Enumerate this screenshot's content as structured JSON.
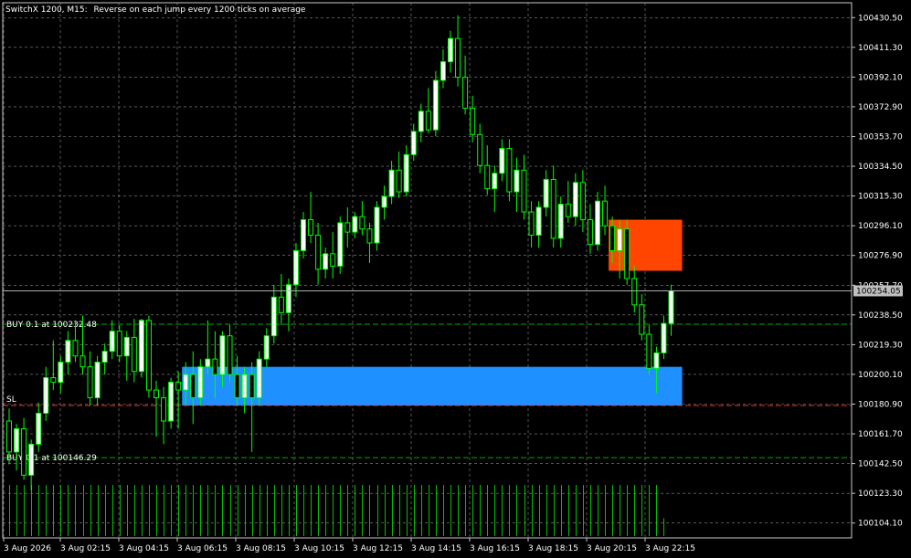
{
  "header": {
    "symbol_period": "SwitchX 1200, M15:",
    "description": "Reverse on each jump every 1200 ticks on average"
  },
  "colors": {
    "background": "#000000",
    "grid": "#8a8a8a",
    "frame": "#c8c8c8",
    "text": "#ffffff",
    "bull_candle": "#ffffff",
    "bear_candle": "#000000",
    "candle_outline": "#00ff00",
    "volume": "#00c000",
    "buy_zone": "#1e90ff",
    "sell_zone": "#ff4500",
    "sl_line": "#ff3030",
    "price_line": "#b0b0b0",
    "current_price_bg": "#c0c0c0",
    "order_line": "#00aa00"
  },
  "price_axis": {
    "labels": [
      "100430.50",
      "100411.30",
      "100392.10",
      "100372.90",
      "100353.70",
      "100334.50",
      "100315.30",
      "100296.10",
      "100276.90",
      "100257.70",
      "100238.50",
      "100219.30",
      "100200.10",
      "100180.90",
      "100161.70",
      "100142.50",
      "100123.30",
      "100104.10"
    ],
    "current_price": "100254.05"
  },
  "time_axis": {
    "labels": [
      "3 Aug 2026",
      "3 Aug 02:15",
      "3 Aug 04:15",
      "3 Aug 06:15",
      "3 Aug 08:15",
      "3 Aug 10:15",
      "3 Aug 12:15",
      "3 Aug 14:15",
      "3 Aug 16:15",
      "3 Aug 18:15",
      "3 Aug 20:15",
      "3 Aug 22:15"
    ]
  },
  "orders": [
    {
      "label": "BUY 0.1 at 100232.48",
      "price": 100232.48
    },
    {
      "label": "BUY 0.1 at 100146.29",
      "price": 100146.29
    }
  ],
  "sl_label": "SL",
  "sl_price": 100180.0,
  "zones": [
    {
      "kind": "buy",
      "price_top": 100205.0,
      "price_bottom": 100180.0,
      "from_index": 24,
      "to_index": 91
    },
    {
      "kind": "sell",
      "price_top": 100300.0,
      "price_bottom": 100267.0,
      "from_index": 82,
      "to_index": 91
    }
  ],
  "chart_data": {
    "type": "candlestick",
    "y_range": [
      100094.5,
      100440.1
    ],
    "ohlc": [
      [
        100170,
        100178,
        100142,
        100150
      ],
      [
        100150,
        100168,
        100138,
        100165
      ],
      [
        100165,
        100172,
        100132,
        100135
      ],
      [
        100135,
        100158,
        100125,
        100155
      ],
      [
        100155,
        100182,
        100150,
        100175
      ],
      [
        100175,
        100205,
        100170,
        100198
      ],
      [
        100198,
        100222,
        100190,
        100195
      ],
      [
        100195,
        100212,
        100188,
        100208
      ],
      [
        100208,
        100228,
        100200,
        100222
      ],
      [
        100222,
        100235,
        100208,
        100212
      ],
      [
        100212,
        100238,
        100200,
        100205
      ],
      [
        100205,
        100215,
        100180,
        100185
      ],
      [
        100185,
        100212,
        100180,
        100208
      ],
      [
        100208,
        100220,
        100200,
        100215
      ],
      [
        100215,
        100235,
        100210,
        100228
      ],
      [
        100228,
        100232,
        100208,
        100212
      ],
      [
        100212,
        100228,
        100196,
        100224
      ],
      [
        100224,
        100236,
        100195,
        100202
      ],
      [
        100202,
        100236,
        100198,
        100235
      ],
      [
        100235,
        100238,
        100185,
        100190
      ],
      [
        100190,
        100196,
        100160,
        100185
      ],
      [
        100185,
        100192,
        100155,
        100170
      ],
      [
        100170,
        100198,
        100165,
        100195
      ],
      [
        100195,
        100202,
        100165,
        100190
      ],
      [
        100190,
        100208,
        100180,
        100200
      ],
      [
        100200,
        100215,
        100168,
        100185
      ],
      [
        100185,
        100210,
        100180,
        100205
      ],
      [
        100205,
        100235,
        100200,
        100210
      ],
      [
        100210,
        100228,
        100185,
        100200
      ],
      [
        100200,
        100228,
        100192,
        100225
      ],
      [
        100225,
        100232,
        100195,
        100200
      ],
      [
        100200,
        100212,
        100180,
        100185
      ],
      [
        100185,
        100205,
        100175,
        100200
      ],
      [
        100200,
        100208,
        100150,
        100185
      ],
      [
        100185,
        100215,
        100180,
        100210
      ],
      [
        100210,
        100230,
        100205,
        100225
      ],
      [
        100225,
        100258,
        100220,
        100250
      ],
      [
        100250,
        100265,
        100232,
        100240
      ],
      [
        100240,
        100262,
        100228,
        100258
      ],
      [
        100258,
        100285,
        100250,
        100280
      ],
      [
        100280,
        100305,
        100275,
        100300
      ],
      [
        100300,
        100318,
        100285,
        100290
      ],
      [
        100290,
        100298,
        100258,
        100268
      ],
      [
        100268,
        100282,
        100262,
        100278
      ],
      [
        100278,
        100292,
        100262,
        100270
      ],
      [
        100270,
        100302,
        100265,
        100298
      ],
      [
        100298,
        100308,
        100282,
        100292
      ],
      [
        100292,
        100305,
        100288,
        100302
      ],
      [
        100302,
        100312,
        100290,
        100294
      ],
      [
        100294,
        100298,
        100272,
        100285
      ],
      [
        100285,
        100312,
        100280,
        100308
      ],
      [
        100308,
        100322,
        100300,
        100315
      ],
      [
        100315,
        100338,
        100310,
        100332
      ],
      [
        100332,
        100344,
        100314,
        100318
      ],
      [
        100318,
        100348,
        100315,
        100342
      ],
      [
        100342,
        100362,
        100338,
        100357
      ],
      [
        100357,
        100375,
        100350,
        100370
      ],
      [
        100370,
        100385,
        100356,
        100358
      ],
      [
        100358,
        100396,
        100354,
        100390
      ],
      [
        100390,
        100410,
        100385,
        100402
      ],
      [
        100402,
        100422,
        100395,
        100417
      ],
      [
        100417,
        100432,
        100386,
        100392
      ],
      [
        100392,
        100406,
        100368,
        100372
      ],
      [
        100372,
        100380,
        100350,
        100355
      ],
      [
        100355,
        100362,
        100330,
        100335
      ],
      [
        100335,
        100348,
        100316,
        100320
      ],
      [
        100320,
        100335,
        100305,
        100330
      ],
      [
        100330,
        100352,
        100325,
        100346
      ],
      [
        100346,
        100352,
        100312,
        100318
      ],
      [
        100318,
        100340,
        100305,
        100332
      ],
      [
        100332,
        100342,
        100300,
        100305
      ],
      [
        100305,
        100312,
        100282,
        100290
      ],
      [
        100290,
        100312,
        100282,
        100308
      ],
      [
        100308,
        100332,
        100302,
        100326
      ],
      [
        100326,
        100335,
        100282,
        100288
      ],
      [
        100288,
        100315,
        100282,
        100310
      ],
      [
        100310,
        100325,
        100298,
        100302
      ],
      [
        100302,
        100330,
        100296,
        100324
      ],
      [
        100324,
        100332,
        100292,
        100300
      ],
      [
        100300,
        100310,
        100278,
        100284
      ],
      [
        100284,
        100318,
        100280,
        100312
      ],
      [
        100312,
        100322,
        100290,
        100296
      ],
      [
        100296,
        100302,
        100272,
        100280
      ],
      [
        100280,
        100300,
        100262,
        100294
      ],
      [
        100294,
        100300,
        100258,
        100262
      ],
      [
        100262,
        100270,
        100240,
        100245
      ],
      [
        100245,
        100252,
        100222,
        100226
      ],
      [
        100226,
        100232,
        100200,
        100204
      ],
      [
        100204,
        100218,
        100188,
        100214
      ],
      [
        100214,
        100238,
        100210,
        100233
      ],
      [
        100233,
        100258,
        100225,
        100254
      ]
    ],
    "volume_relative": [
      1,
      1,
      1,
      1,
      1,
      1,
      1,
      1,
      1,
      1,
      1,
      1,
      1,
      1,
      1,
      1,
      1,
      1,
      1,
      1,
      1,
      1,
      1,
      1,
      1,
      1,
      1,
      1,
      1,
      1,
      1,
      1,
      1,
      1,
      1,
      1,
      1,
      1,
      1,
      1,
      1,
      1,
      1,
      1,
      1,
      1,
      1,
      1,
      1,
      1,
      1,
      1,
      1,
      1,
      1,
      1,
      1,
      1,
      1,
      1,
      1,
      1,
      1,
      1,
      1,
      1,
      1,
      1,
      1,
      1,
      1,
      1,
      1,
      1,
      1,
      1,
      1,
      1,
      1,
      1,
      1,
      1,
      1,
      1,
      1,
      1,
      1,
      1,
      1,
      0.35
    ]
  }
}
